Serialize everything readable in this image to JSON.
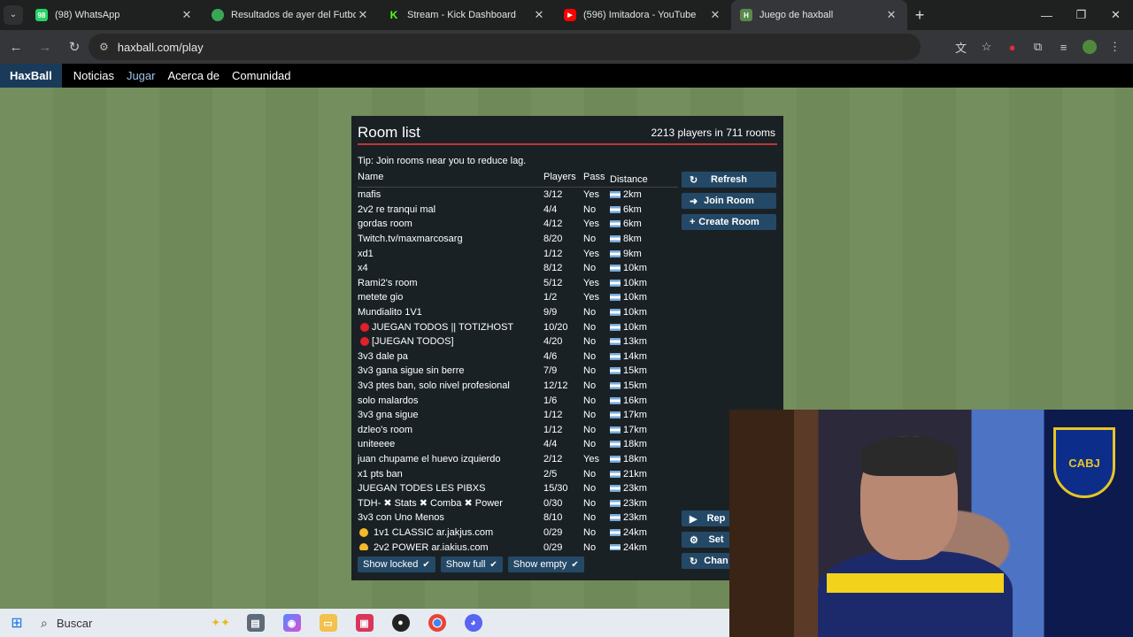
{
  "browser": {
    "tabs": [
      {
        "title": "(98) WhatsApp",
        "badge": "98",
        "color": "#25d366"
      },
      {
        "title": "Resultados de ayer del Futbol A",
        "color": "#3aa757"
      },
      {
        "title": "Stream - Kick Dashboard",
        "badge": "K",
        "color": "#53fc18"
      },
      {
        "title": "(596) Imitadora - YouTube",
        "color": "#ff0000"
      },
      {
        "title": "Juego de haxball",
        "badge": "H",
        "color": "#5a8a4a"
      }
    ],
    "url": "haxball.com/play"
  },
  "site_nav": {
    "brand": "HaxBall",
    "links": [
      "Noticias",
      "Jugar",
      "Acerca de",
      "Comunidad"
    ]
  },
  "room_list": {
    "title": "Room list",
    "summary": "2213 players in 711 rooms",
    "tip": "Tip: Join rooms near you to reduce lag.",
    "columns": {
      "name": "Name",
      "players": "Players",
      "pass": "Pass",
      "distance": "Distance"
    },
    "rooms": [
      {
        "name": "mafis",
        "players": "3/12",
        "pass": "Yes",
        "distance": "2km"
      },
      {
        "name": "2v2 re tranqui mal",
        "players": "4/4",
        "pass": "No",
        "distance": "6km"
      },
      {
        "name": "gordas room",
        "players": "4/12",
        "pass": "Yes",
        "distance": "6km"
      },
      {
        "name": "Twitch.tv/maxmarcosarg",
        "players": "8/20",
        "pass": "No",
        "distance": "8km"
      },
      {
        "name": "xd1",
        "players": "1/12",
        "pass": "Yes",
        "distance": "9km"
      },
      {
        "name": "x4",
        "players": "8/12",
        "pass": "No",
        "distance": "10km"
      },
      {
        "name": "Rami2's room",
        "players": "5/12",
        "pass": "Yes",
        "distance": "10km"
      },
      {
        "name": "metete gio",
        "players": "1/2",
        "pass": "Yes",
        "distance": "10km"
      },
      {
        "name": "Mundialito 1V1",
        "players": "9/9",
        "pass": "No",
        "distance": "10km"
      },
      {
        "name": "JUEGAN TODOS || TOTIZHOST",
        "players": "10/20",
        "pass": "No",
        "distance": "10km"
      },
      {
        "name": "[JUEGAN TODOS]",
        "players": "4/20",
        "pass": "No",
        "distance": "13km"
      },
      {
        "name": "3v3 dale pa",
        "players": "4/6",
        "pass": "No",
        "distance": "14km"
      },
      {
        "name": "3v3 gana sigue sin berre",
        "players": "7/9",
        "pass": "No",
        "distance": "15km"
      },
      {
        "name": "3v3 ptes ban, solo nivel profesional",
        "players": "12/12",
        "pass": "No",
        "distance": "15km"
      },
      {
        "name": "solo malardos",
        "players": "1/6",
        "pass": "No",
        "distance": "16km"
      },
      {
        "name": "3v3 gna sigue",
        "players": "1/12",
        "pass": "No",
        "distance": "17km"
      },
      {
        "name": "dzleo's room",
        "players": "1/12",
        "pass": "No",
        "distance": "17km"
      },
      {
        "name": "uniteeee",
        "players": "4/4",
        "pass": "No",
        "distance": "18km"
      },
      {
        "name": "juan chupame el huevo izquierdo",
        "players": "2/12",
        "pass": "Yes",
        "distance": "18km"
      },
      {
        "name": "x1 pts ban",
        "players": "2/5",
        "pass": "No",
        "distance": "21km"
      },
      {
        "name": "JUEGAN TODES LES PIBXS",
        "players": "15/30",
        "pass": "No",
        "distance": "23km"
      },
      {
        "name": "TDH- ✖ Stats ✖ Comba ✖ Power",
        "players": "0/30",
        "pass": "No",
        "distance": "23km"
      },
      {
        "name": "3v3 con Uno Menos",
        "players": "8/10",
        "pass": "No",
        "distance": "23km"
      },
      {
        "name": "1v1 CLASSIC ar.jakjus.com",
        "players": "0/29",
        "pass": "No",
        "distance": "24km"
      },
      {
        "name": "2v2 POWER ar.jakjus.com",
        "players": "0/29",
        "pass": "No",
        "distance": "24km"
      }
    ],
    "buttons": {
      "refresh": "Refresh",
      "join": "Join Room",
      "create": "Create Room"
    },
    "bottom_buttons": {
      "replays": "Rep",
      "settings": "Set",
      "change": "Chan"
    },
    "filters": {
      "locked": "Show locked",
      "full": "Show full",
      "empty": "Show empty"
    }
  },
  "taskbar": {
    "search": "Buscar"
  }
}
